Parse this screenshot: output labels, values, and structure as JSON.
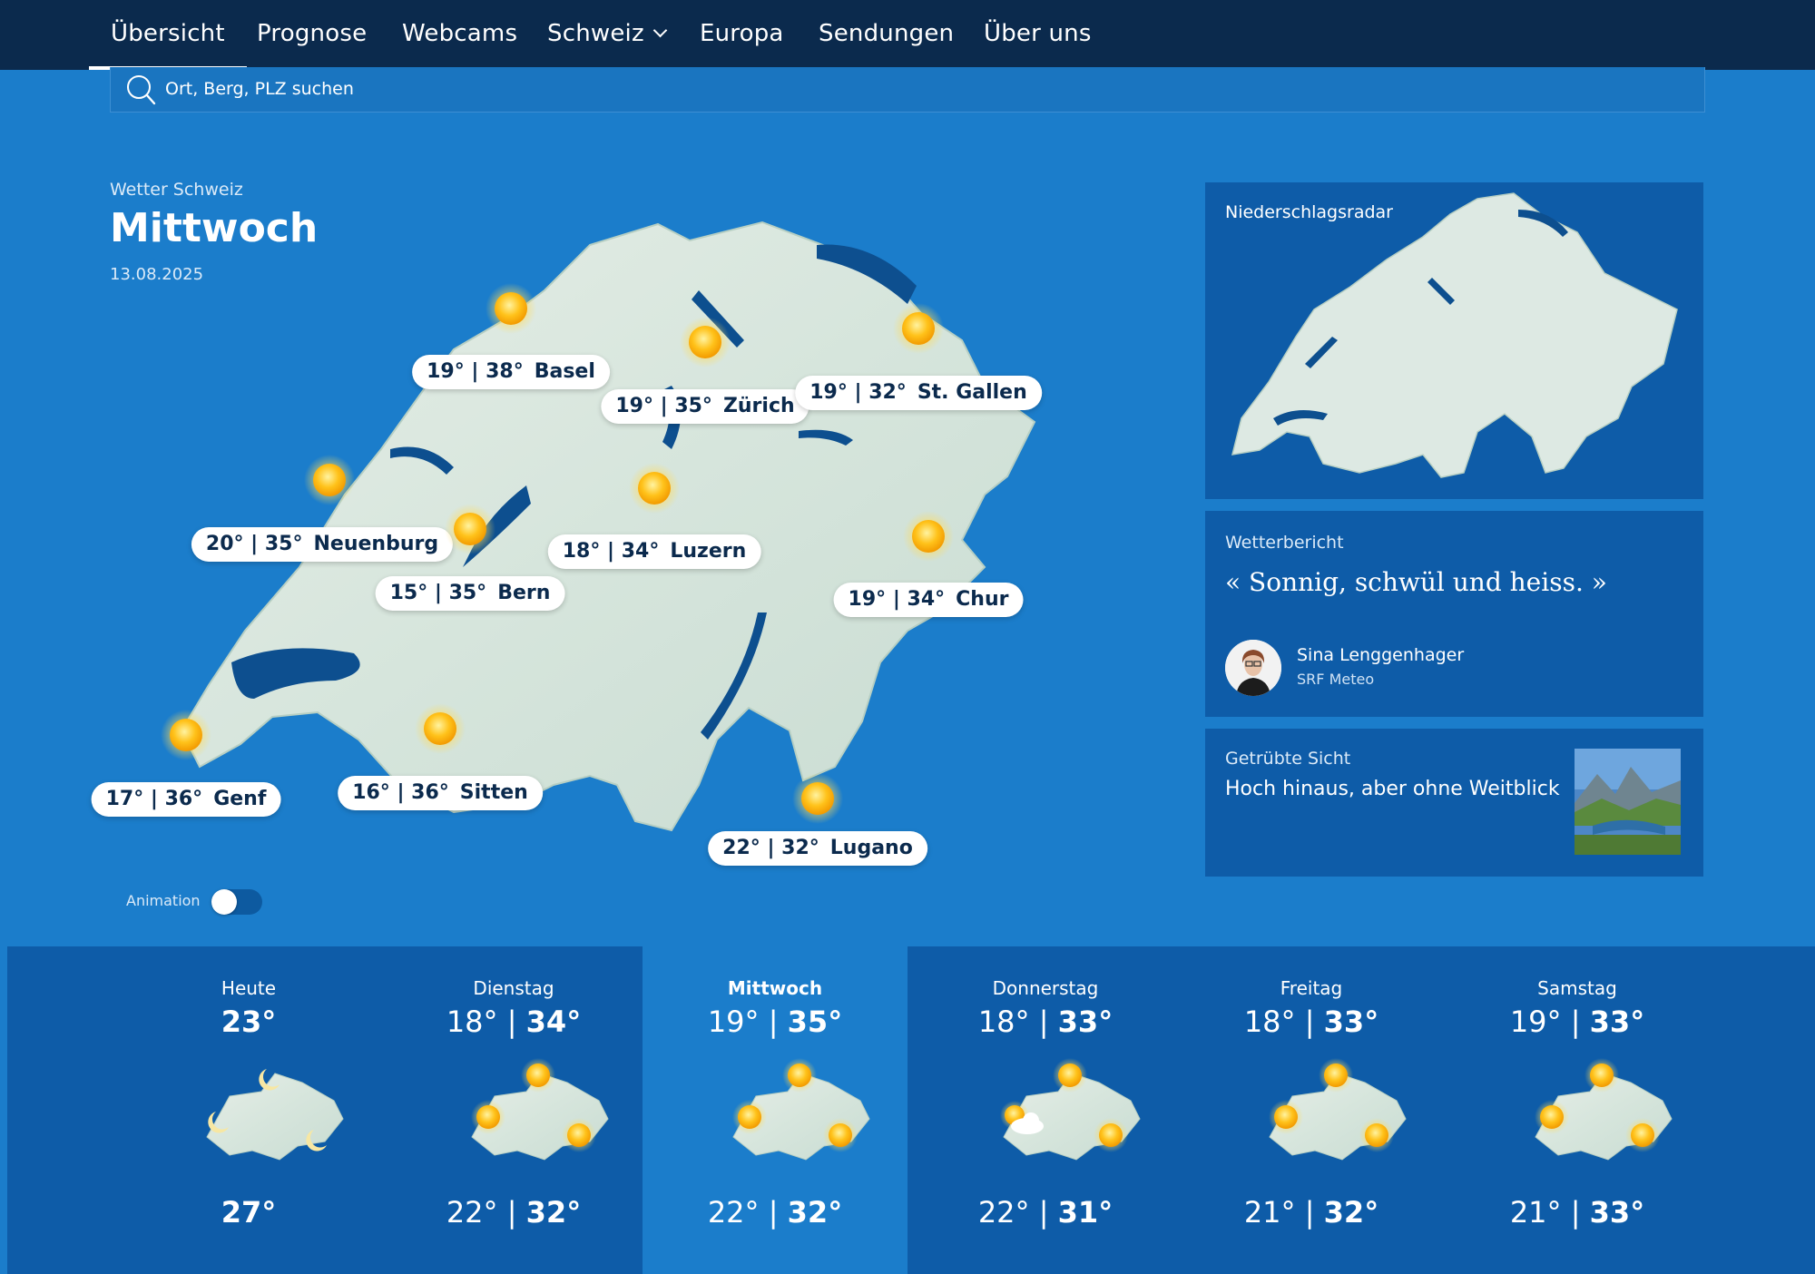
{
  "nav": {
    "items": [
      {
        "label": "Übersicht",
        "active": true
      },
      {
        "label": "Prognose"
      },
      {
        "label": "Webcams"
      },
      {
        "label": "Schweiz",
        "has_dropdown": true
      },
      {
        "label": "Europa"
      },
      {
        "label": "Sendungen"
      },
      {
        "label": "Über uns"
      }
    ]
  },
  "search": {
    "placeholder": "Ort, Berg, PLZ suchen"
  },
  "header": {
    "kicker": "Wetter Schweiz",
    "title": "Mittwoch",
    "date": "13.08.2025"
  },
  "map": {
    "icon": "sun-icon",
    "locations": [
      {
        "name": "Basel",
        "temps": "19° | 38°"
      },
      {
        "name": "Zürich",
        "temps": "19° | 35°"
      },
      {
        "name": "St. Gallen",
        "temps": "19° | 32°"
      },
      {
        "name": "Neuenburg",
        "temps": "20° | 35°"
      },
      {
        "name": "Luzern",
        "temps": "18° | 34°"
      },
      {
        "name": "Bern",
        "temps": "15° | 35°"
      },
      {
        "name": "Chur",
        "temps": "19° | 34°"
      },
      {
        "name": "Genf",
        "temps": "17° | 36°"
      },
      {
        "name": "Sitten",
        "temps": "16° | 36°"
      },
      {
        "name": "Lugano",
        "temps": "22° | 32°"
      }
    ]
  },
  "animation": {
    "label": "Animation",
    "enabled": false
  },
  "radar": {
    "title": "Niederschlagsradar"
  },
  "report": {
    "kicker": "Wetterbericht",
    "quote": "« Sonnig, schwül und heiss. »",
    "author": "Sina Lenggenhager",
    "org": "SRF Meteo"
  },
  "story": {
    "kicker": "Getrübte Sicht",
    "title": "Hoch hinaus, aber ohne Weitblick"
  },
  "forecast": [
    {
      "day": "Heute",
      "min": "",
      "max": "23°",
      "eve_min": "",
      "eve_max": "27°",
      "icon": "moon-icon"
    },
    {
      "day": "Dienstag",
      "min": "18° | ",
      "max": "34°",
      "eve_min": "22° | ",
      "eve_max": "32°",
      "icon": "sun-icon"
    },
    {
      "day": "Mittwoch",
      "min": "19° | ",
      "max": "35°",
      "eve_min": "22° | ",
      "eve_max": "32°",
      "icon": "sun-icon",
      "active": true
    },
    {
      "day": "Donnerstag",
      "min": "18° | ",
      "max": "33°",
      "eve_min": "22° | ",
      "eve_max": "31°",
      "icon": "sun-cloud-icon"
    },
    {
      "day": "Freitag",
      "min": "18° | ",
      "max": "33°",
      "eve_min": "21° | ",
      "eve_max": "32°",
      "icon": "sun-icon"
    },
    {
      "day": "Samstag",
      "min": "19° | ",
      "max": "33°",
      "eve_min": "21° | ",
      "eve_max": "33°",
      "icon": "sun-icon"
    }
  ],
  "colors": {
    "page": "#1b7dcb",
    "nav": "#0b2a4d",
    "panel": "#0e5ca8",
    "land": "#dbe8e2",
    "water": "#0d4f8f",
    "sun": "#ffc21a"
  }
}
